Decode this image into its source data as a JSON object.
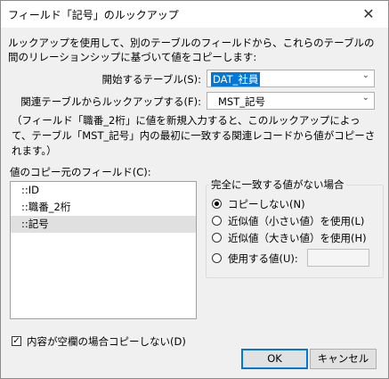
{
  "window": {
    "title": "フィールド「記号」のルックアップ",
    "close_glyph": "✕"
  },
  "description": "ルックアップを使用して、別のテーブルのフィールドから、これらのテーブルの間のリレーションシップに基づいて値をコピーします:",
  "start_table": {
    "label": "開始するテーブル(S):",
    "value": "DAT_社員"
  },
  "lookup_table": {
    "label": "関連テーブルからルックアップする(F):",
    "value": "MST_記号"
  },
  "note": "（フィールド「職番_2桁」に値を新規入力すると、このルックアップによって、テーブル「MST_記号」内の最初に一致する関連レコードから値がコピーされます。）",
  "source_field": {
    "label": "値のコピー元のフィールド(C):",
    "items": [
      "::ID",
      "::職番_2桁",
      "::記号"
    ],
    "selected_index": 2
  },
  "no_match": {
    "legend": "完全に一致する値がない場合",
    "options": [
      {
        "label": "コピーしない(N)",
        "selected": true
      },
      {
        "label": "近似値（小さい値）を使用(L)",
        "selected": false
      },
      {
        "label": "近似値（大きい値）を使用(H)",
        "selected": false
      },
      {
        "label": "使用する値(U):",
        "selected": false
      }
    ],
    "use_value": ""
  },
  "dont_copy_if_empty": {
    "label": "内容が空欄の場合コピーしない(D)",
    "checked": true
  },
  "buttons": {
    "ok": "OK",
    "cancel": "キャンセル"
  }
}
